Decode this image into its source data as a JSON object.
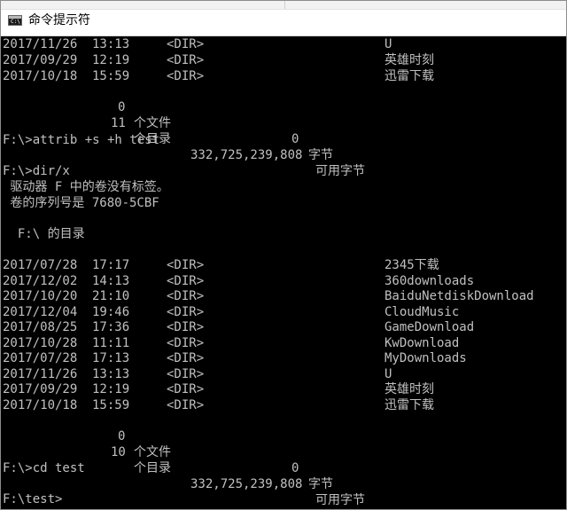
{
  "window": {
    "title": "命令提示符",
    "icon_text": "C:\\",
    "icon": "console-icon"
  },
  "console": {
    "top_listing": [
      {
        "date": "2017/11/26",
        "time": "13:13",
        "type": "<DIR>",
        "name": "U"
      },
      {
        "date": "2017/09/29",
        "time": "12:19",
        "type": "<DIR>",
        "name": "英雄时刻"
      },
      {
        "date": "2017/10/18",
        "time": "15:59",
        "type": "<DIR>",
        "name": "迅雷下载"
      }
    ],
    "top_summary": {
      "files_count": "0",
      "files_label": "个文件",
      "files_bytes": "0",
      "bytes_label": "字节",
      "dirs_count": "11",
      "dirs_label": "个目录",
      "free_bytes": "332,725,239,808",
      "free_label": "可用字节"
    },
    "cmd1": "F:\\>attrib +s +h test",
    "cmd2": "F:\\>dir/x",
    "volume_line": " 驱动器 F 中的卷没有标签。",
    "serial_line": " 卷的序列号是 7680-5CBF",
    "dir_of_line": "  F:\\ 的目录",
    "listing": [
      {
        "date": "2017/07/28",
        "time": "17:17",
        "type": "<DIR>",
        "name": "2345下载"
      },
      {
        "date": "2017/12/02",
        "time": "14:13",
        "type": "<DIR>",
        "name": "360downloads"
      },
      {
        "date": "2017/10/20",
        "time": "21:10",
        "type": "<DIR>",
        "name": "BaiduNetdiskDownload"
      },
      {
        "date": "2017/12/04",
        "time": "19:46",
        "type": "<DIR>",
        "name": "CloudMusic"
      },
      {
        "date": "2017/08/25",
        "time": "17:36",
        "type": "<DIR>",
        "name": "GameDownload"
      },
      {
        "date": "2017/10/28",
        "time": "11:11",
        "type": "<DIR>",
        "name": "KwDownload"
      },
      {
        "date": "2017/07/28",
        "time": "17:13",
        "type": "<DIR>",
        "name": "MyDownloads"
      },
      {
        "date": "2017/11/26",
        "time": "13:13",
        "type": "<DIR>",
        "name": "U"
      },
      {
        "date": "2017/09/29",
        "time": "12:19",
        "type": "<DIR>",
        "name": "英雄时刻"
      },
      {
        "date": "2017/10/18",
        "time": "15:59",
        "type": "<DIR>",
        "name": "迅雷下载"
      }
    ],
    "summary": {
      "files_count": "0",
      "files_label": "个文件",
      "files_bytes": "0",
      "bytes_label": "字节",
      "dirs_count": "10",
      "dirs_label": "个目录",
      "free_bytes": "332,725,239,808",
      "free_label": "可用字节"
    },
    "cmd3": "F:\\>cd test",
    "prompt": "F:\\test>"
  },
  "colors": {
    "console_bg": "#000000",
    "console_fg": "#c0c0c0",
    "titlebar_bg": "#ffffff"
  }
}
